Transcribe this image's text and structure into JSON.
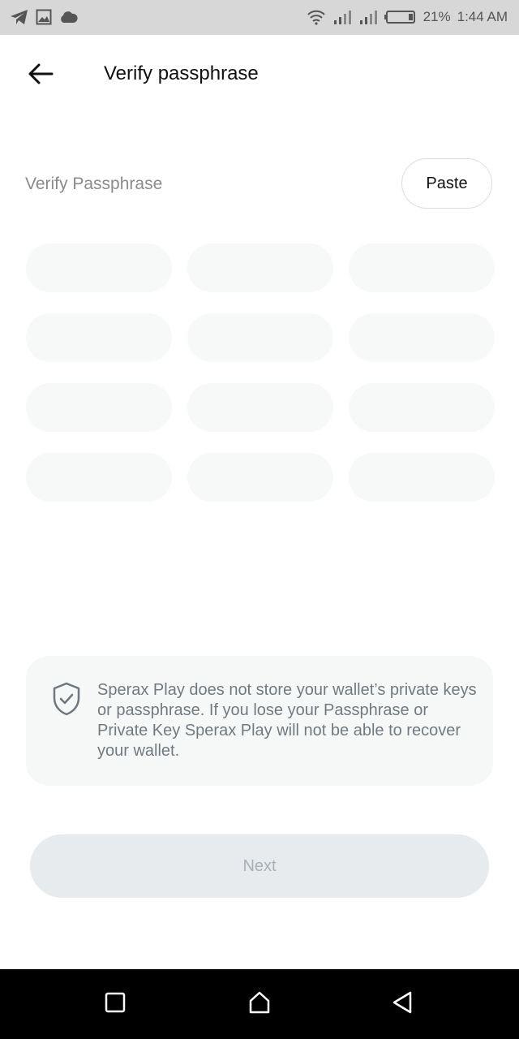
{
  "status_bar": {
    "battery": "21%",
    "time": "1:44 AM",
    "left_icons": [
      "telegram-icon",
      "image-icon",
      "cloud-icon"
    ],
    "right_icons": [
      "wifi-icon",
      "signal-icon",
      "signal-icon",
      "battery-icon"
    ]
  },
  "header": {
    "title": "Verify passphrase",
    "back_icon": "arrow-left-icon"
  },
  "verify": {
    "label": "Verify Passphrase",
    "paste_label": "Paste"
  },
  "word_slots": [
    "",
    "",
    "",
    "",
    "",
    "",
    "",
    "",
    "",
    "",
    "",
    ""
  ],
  "notice": {
    "icon": "shield-check-icon",
    "text": "Sperax Play does not store your wallet’s private keys or passphrase. If you lose your Passphrase or Private Key Sperax Play will not be able to recover your wallet."
  },
  "next_label": "Next",
  "nav": {
    "icons": [
      "square-icon",
      "home-icon",
      "back-triangle-icon"
    ]
  },
  "colors": {
    "slot_bg": "#f7f8f8",
    "next_bg": "#e8ebed",
    "next_text": "#a8afb5",
    "notice_text": "#727a80"
  }
}
